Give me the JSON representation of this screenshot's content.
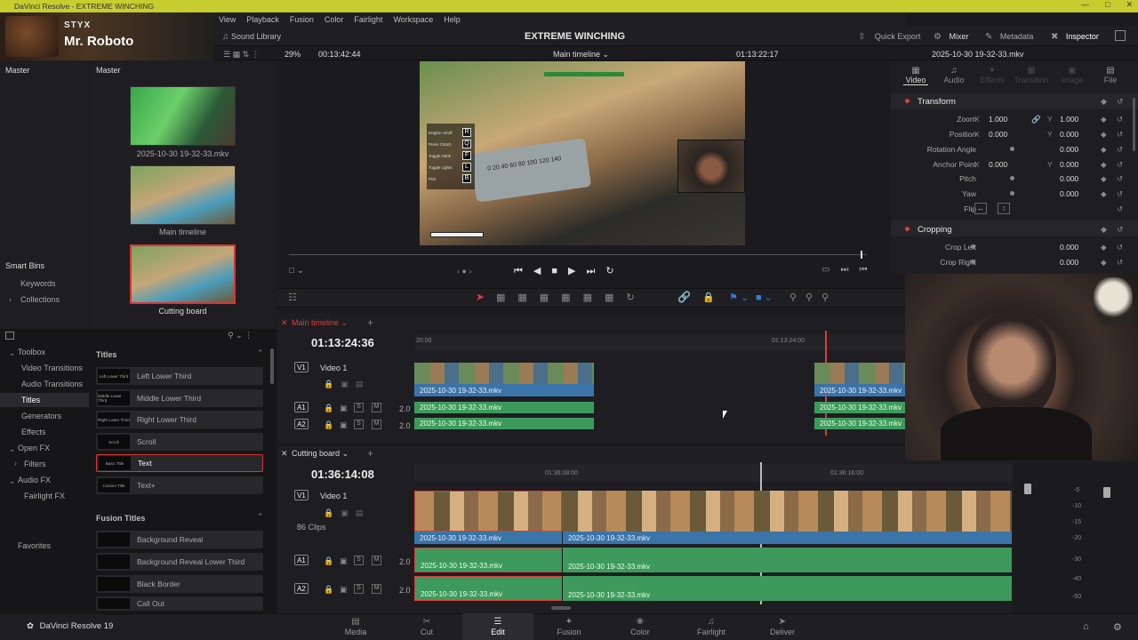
{
  "window": {
    "title": "DaVinci Resolve - EXTREME WINCHING"
  },
  "streamer": {
    "channel": "STYX",
    "name": "Mr. Roboto"
  },
  "menu": [
    "View",
    "Playback",
    "Fusion",
    "Color",
    "Fairlight",
    "Workspace",
    "Help"
  ],
  "topbar": {
    "sound_library": "Sound Library",
    "project_title": "EXTREME WINCHING",
    "quick_export": "Quick Export",
    "mixer": "Mixer",
    "metadata": "Metadata",
    "inspector": "Inspector"
  },
  "viewer_bar": {
    "zoom": "29%",
    "source_tc": "00:13:42:44",
    "timeline_name": "Main timeline",
    "record_tc": "01:13:22:17",
    "clip_name": "2025-10-30 19-32-33.mkv"
  },
  "media_pool": {
    "bin_left": "Master",
    "bin_right": "Master",
    "items": [
      {
        "name": "2025-10-30 19-32-33.mkv"
      },
      {
        "name": "Main timeline"
      },
      {
        "name": "Cutting board"
      }
    ],
    "smart_bins": "Smart Bins",
    "smart_items": [
      "Keywords",
      "Collections"
    ]
  },
  "toolbox": {
    "items": [
      "Toolbox",
      "Video Transitions",
      "Audio Transitions",
      "Titles",
      "Generators",
      "Effects",
      "Open FX",
      "Filters",
      "Audio FX",
      "Fairlight FX"
    ],
    "favorites": "Favorites",
    "titles_header": "Titles",
    "titles": [
      {
        "thumb": "Left Lower Third",
        "label": "Left Lower Third"
      },
      {
        "thumb": "Middle Lower Third",
        "label": "Middle Lower Third"
      },
      {
        "thumb": "Right Lower Third",
        "label": "Right Lower Third"
      },
      {
        "thumb": "Scroll",
        "label": "Scroll"
      },
      {
        "thumb": "Basic Title",
        "label": "Text"
      },
      {
        "thumb": "Custom Title",
        "label": "Text+"
      }
    ],
    "fusion_header": "Fusion Titles",
    "fusion_titles": [
      {
        "label": "Background Reveal"
      },
      {
        "label": "Background Reveal Lower Third"
      },
      {
        "label": "Black Border"
      },
      {
        "label": "Call Out"
      }
    ]
  },
  "inspector": {
    "tabs": [
      "Video",
      "Audio",
      "Effects",
      "Transition",
      "Image",
      "File"
    ],
    "transform_header": "Transform",
    "zoom": {
      "label": "Zoom",
      "x": "1.000",
      "y": "1.000"
    },
    "position": {
      "label": "Position",
      "x": "0.000",
      "y": "0.000"
    },
    "rotation": {
      "label": "Rotation Angle",
      "value": "0.000"
    },
    "anchor": {
      "label": "Anchor Point",
      "x": "0.000",
      "y": "0.000"
    },
    "pitch": {
      "label": "Pitch",
      "value": "0.000"
    },
    "yaw": {
      "label": "Yaw",
      "value": "0.000"
    },
    "flip": {
      "label": "Flip"
    },
    "cropping_header": "Cropping",
    "crop_left": {
      "label": "Crop Left",
      "value": "0.000"
    },
    "crop_right": {
      "label": "Crop Right",
      "value": "0.000"
    },
    "axis_x": "X",
    "axis_y": "Y"
  },
  "main_timeline": {
    "tab": "Main timeline",
    "timecode": "01:13:24:36",
    "ruler_left": "20:00",
    "ruler_right": "01:13:24:00",
    "v1": {
      "badge": "V1",
      "name": "Video 1"
    },
    "a1": {
      "badge": "A1",
      "level": "2.0"
    },
    "a2": {
      "badge": "A2",
      "level": "2.0"
    },
    "clip": "2025-10-30 19-32-33.mkv"
  },
  "cutting_board": {
    "tab": "Cutting board",
    "timecode": "01:36:14:08",
    "ruler_left": "01:36:08:00",
    "ruler_right": "01:36:16:00",
    "v1": {
      "badge": "V1",
      "name": "Video 1",
      "clips": "86 Clips"
    },
    "a1": {
      "badge": "A1",
      "level": "2.0"
    },
    "a2": {
      "badge": "A2",
      "level": "2.0"
    },
    "clip": "2025-10-30 19-32-33.mkv"
  },
  "track_buttons": {
    "solo": "S",
    "mute": "M"
  },
  "meter_scale": [
    "-5",
    "-10",
    "-15",
    "-20",
    "-30",
    "-40",
    "-50"
  ],
  "hud": {
    "engine": "Engine on/off",
    "clutch": "Press Clutch",
    "handbrake": "Toggle Hank",
    "lights": "Toggle Lights",
    "pick": "Pick",
    "keys": [
      "R",
      "Q",
      "F",
      "L",
      "B"
    ],
    "speedo": "0 20 40 60 80 100 120 140"
  },
  "app": {
    "name": "DaVinci Resolve 19"
  },
  "pages": [
    "Media",
    "Cut",
    "Edit",
    "Fusion",
    "Color",
    "Fairlight",
    "Deliver"
  ],
  "colors": {
    "accent_red": "#e03a3a",
    "clip_blue": "#3b74a8",
    "clip_green": "#3e9a5c",
    "titlebar": "#c7cc2f"
  }
}
